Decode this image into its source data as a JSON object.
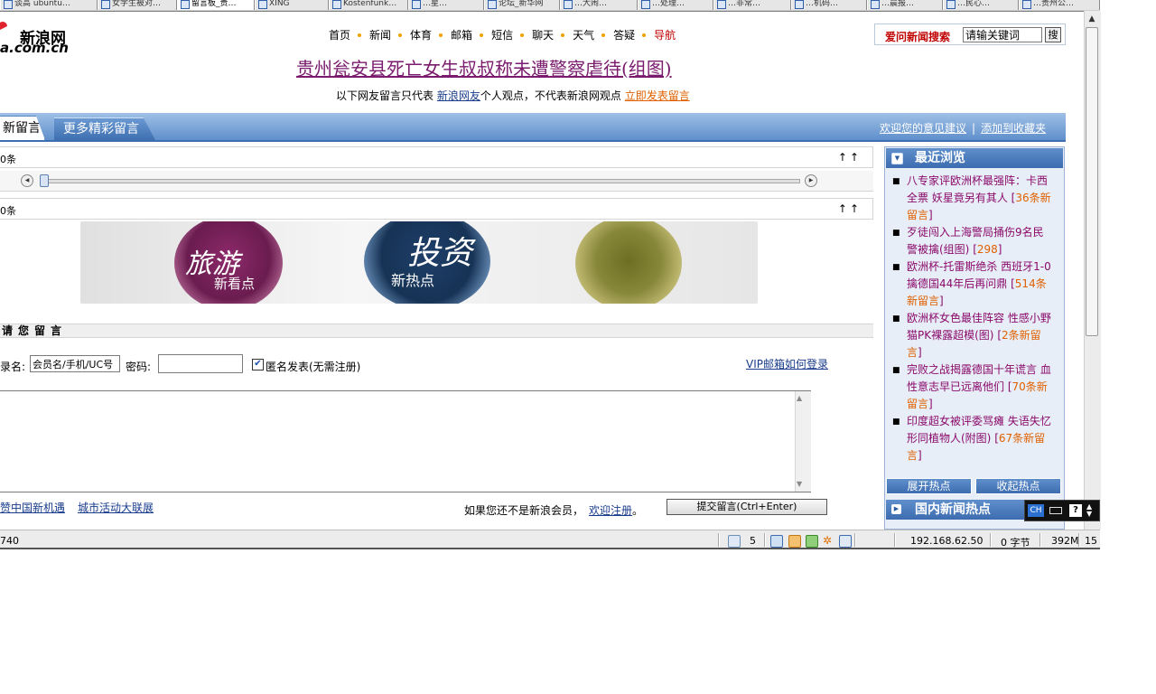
{
  "browser": {
    "tabs": [
      {
        "label": "谈高 ubuntu…",
        "active": false
      },
      {
        "label": "女学生被对…",
        "active": false
      },
      {
        "label": "留言板_贵…",
        "active": true
      },
      {
        "label": "XING",
        "active": false
      },
      {
        "label": "Kostenfunk…",
        "active": false
      },
      {
        "label": "…星…",
        "active": false
      },
      {
        "label": "论坛_新华网",
        "active": false
      },
      {
        "label": "…大闹…",
        "active": false
      },
      {
        "label": "…处理…",
        "active": false
      },
      {
        "label": "…非常…",
        "active": false
      },
      {
        "label": "…机码…",
        "active": false
      },
      {
        "label": "…晨报…",
        "active": false
      },
      {
        "label": "…民心…",
        "active": false
      },
      {
        "label": "…贵州公…",
        "active": false
      }
    ]
  },
  "header": {
    "logo_cn": "新浪网",
    "logo_en": "a.com.cn",
    "nav": [
      {
        "label": "首页",
        "red": false
      },
      {
        "label": "新闻",
        "red": false
      },
      {
        "label": "体育",
        "red": false
      },
      {
        "label": "邮箱",
        "red": false
      },
      {
        "label": "短信",
        "red": false
      },
      {
        "label": "聊天",
        "red": false
      },
      {
        "label": "天气",
        "red": false
      },
      {
        "label": "答疑",
        "red": false
      },
      {
        "label": "导航",
        "red": true
      }
    ],
    "search": {
      "label": "爱问新闻搜索",
      "value": "请输关键词",
      "button": "搜"
    },
    "headline": "贵州瓮安县死亡女生叔叔称未遭警察虐待(组图)",
    "notice_prefix": "以下网友留言只代表",
    "notice_link": "新浪网友",
    "notice_mid": "个人观点，不代表新浪网观点",
    "notice_post": "立即发表留言"
  },
  "tabbar": {
    "tab_latest": "新留言",
    "tab_more": "更多精彩留言",
    "link_feedback": "欢迎您的意见建议",
    "sep": "|",
    "link_bookmark": "添加到收藏夹"
  },
  "main": {
    "row1_count": "0条",
    "row1_arrows": "↑↑",
    "row2_count": "0条",
    "row2_arrows": "↑↑",
    "slider_position": 0.0,
    "banner": {
      "t1": "旅游",
      "t1s": "新看点",
      "t2": "投资",
      "t2s": "新热点"
    },
    "comment_heading": "请您留言",
    "login_label": "录名:",
    "login_value": "会员名/手机/UC号",
    "password_label": "密码:",
    "password_value": "",
    "anonymous_checked": true,
    "anonymous_label": "匿名发表(无需注册)",
    "vip_link": "VIP邮箱如何登录",
    "comment_text": "",
    "bottom_link_1": "赞中国新机遇",
    "bottom_link_2": "城市活动大联展",
    "register_text": "如果您还不是新浪会员，",
    "register_link": "欢迎注册",
    "register_dot": "。",
    "submit_label": "提交留言(Ctrl+Enter)"
  },
  "sidebar": {
    "heading": "最近浏览",
    "items": [
      {
        "title": "八专家评欧洲杯最强阵：卡西全票 妖星竟另有其人",
        "count": "36条新留言"
      },
      {
        "title": "歹徒闯入上海警局捅伤9名民警被擒(组图)",
        "count": "298"
      },
      {
        "title": "欧洲杯-托雷斯绝杀 西班牙1-0擒德国44年后再问鼎",
        "count": "514条新留言"
      },
      {
        "title": "欧洲杯女色最佳阵容 性感小野猫PK裸露超模(图)",
        "count": "2条新留言"
      },
      {
        "title": "完败之战揭露德国十年谎言 血性意志早已远离他们",
        "count": "70条新留言"
      },
      {
        "title": "印度超女被评委骂瘫 失语失忆形同植物人(附图)",
        "count": "67条新留言"
      }
    ],
    "expand_label": "展开热点",
    "collapse_label": "收起热点",
    "heading2": "国内新闻热点"
  },
  "ime": {
    "mode": "CH",
    "help": "?"
  },
  "statusbar": {
    "left_text": "740",
    "count": "5",
    "ip": "192.168.62.50",
    "bytes": "0 字节",
    "memory": "392M",
    "tail": "15"
  },
  "colors": {
    "accent_blue": "#5f8fcb",
    "headline_purple": "#7a1b6e",
    "link_blue": "#1a3c8c",
    "count_orange": "#e06000",
    "nav_red": "#c00000"
  }
}
